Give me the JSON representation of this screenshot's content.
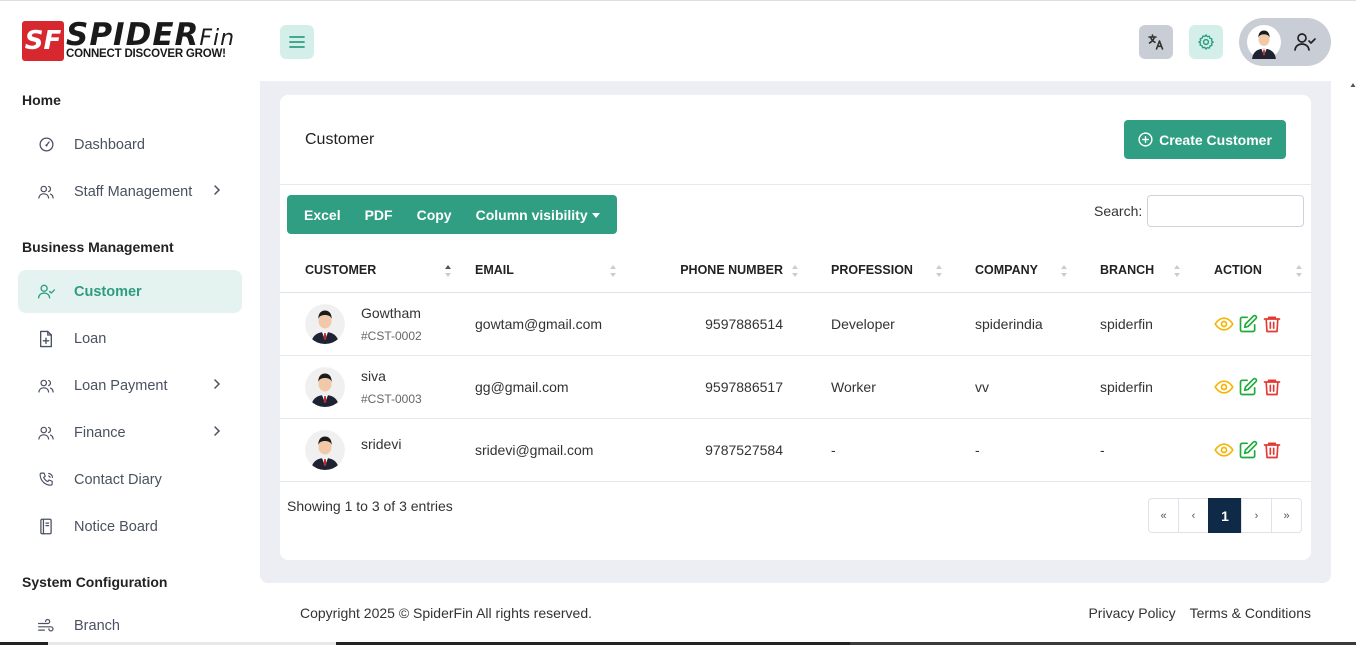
{
  "brand": {
    "mark": "SF",
    "name_main": "SPIDER",
    "name_suffix": "Fin",
    "tagline": "CONNECT DISCOVER GROW!"
  },
  "header": {
    "menu_icon": "hamburger-icon",
    "translate_icon": "translate-icon",
    "settings_icon": "gear-icon",
    "user_icon": "user-check-icon"
  },
  "sidebar": {
    "sections": [
      {
        "title": "Home"
      },
      {
        "title": "Business Management"
      },
      {
        "title": "System Configuration"
      }
    ],
    "items": [
      {
        "label": "Dashboard",
        "icon": "gauge-icon"
      },
      {
        "label": "Staff Management",
        "icon": "users-icon",
        "has_children": true
      },
      {
        "label": "Customer",
        "icon": "user-check-icon",
        "active": true
      },
      {
        "label": "Loan",
        "icon": "file-plus-icon"
      },
      {
        "label": "Loan Payment",
        "icon": "users-icon",
        "has_children": true
      },
      {
        "label": "Finance",
        "icon": "users-icon",
        "has_children": true
      },
      {
        "label": "Contact Diary",
        "icon": "phone-icon"
      },
      {
        "label": "Notice Board",
        "icon": "notebook-icon"
      },
      {
        "label": "Branch",
        "icon": "wind-icon"
      }
    ]
  },
  "page": {
    "title": "Customer",
    "create_label": "Create Customer"
  },
  "toolbar": {
    "excel": "Excel",
    "pdf": "PDF",
    "copy": "Copy",
    "column_visibility": "Column visibility",
    "search_label": "Search:",
    "search_value": ""
  },
  "table": {
    "headers": {
      "customer": "CUSTOMER",
      "email": "EMAIL",
      "phone": "PHONE NUMBER",
      "profession": "PROFESSION",
      "company": "COMPANY",
      "branch": "BRANCH",
      "action": "ACTION"
    },
    "rows": [
      {
        "name": "Gowtham",
        "code": "#CST-0002",
        "email": "gowtam@gmail.com",
        "phone": "9597886514",
        "profession": "Developer",
        "company": "spiderindia",
        "branch": "spiderfin"
      },
      {
        "name": "siva",
        "code": "#CST-0003",
        "email": "gg@gmail.com",
        "phone": "9597886517",
        "profession": "Worker",
        "company": "vv",
        "branch": "spiderfin"
      },
      {
        "name": "sridevi",
        "code": "",
        "email": "sridevi@gmail.com",
        "phone": "9787527584",
        "profession": "-",
        "company": "-",
        "branch": "-"
      }
    ],
    "colors": {
      "view": "#f5b400",
      "edit": "#1faa3c",
      "delete": "#e53935"
    }
  },
  "pagination": {
    "info": "Showing 1 to 3 of 3 entries",
    "first": "«",
    "prev": "‹",
    "current": "1",
    "next": "›",
    "last": "»"
  },
  "footer": {
    "copyright": "Copyright 2025 © SpiderFin All rights reserved.",
    "privacy": "Privacy Policy",
    "terms": "Terms & Conditions"
  },
  "colors": {
    "accent": "#2f9e82",
    "accent_light": "#d4efe9",
    "active_page": "#0e2a47"
  }
}
